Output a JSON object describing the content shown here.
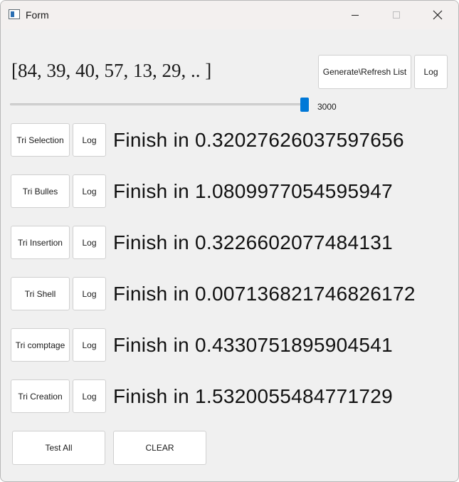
{
  "window": {
    "title": "Form"
  },
  "list_preview": "[84, 39, 40, 57, 13, 29, .. ]",
  "toolbar": {
    "generate_label": "Generate\\Refresh List",
    "log_label": "Log"
  },
  "slider": {
    "value": "3000",
    "position_fraction": 0.97
  },
  "sorts": [
    {
      "label": "Tri Selection",
      "log_label": "Log",
      "result": "Finish in 0.32027626037597656"
    },
    {
      "label": "Tri Bulles",
      "log_label": "Log",
      "result": "Finish in 1.0809977054595947"
    },
    {
      "label": "Tri Insertion",
      "log_label": "Log",
      "result": "Finish in 0.3226602077484131"
    },
    {
      "label": "Tri Shell",
      "log_label": "Log",
      "result": "Finish in 0.007136821746826172"
    },
    {
      "label": "Tri comptage",
      "log_label": "Log",
      "result": "Finish in 0.4330751895904541"
    },
    {
      "label": "Tri Creation",
      "log_label": "Log",
      "result": "Finish in 1.5320055484771729"
    }
  ],
  "footer": {
    "test_all_label": "Test All",
    "clear_label": "CLEAR"
  },
  "colors": {
    "window_bg": "#f0f0f0",
    "accent": "#0078d7"
  },
  "icons": {
    "app": "form-window-icon",
    "minimize": "minimize-icon",
    "maximize": "maximize-icon",
    "close": "close-icon"
  }
}
